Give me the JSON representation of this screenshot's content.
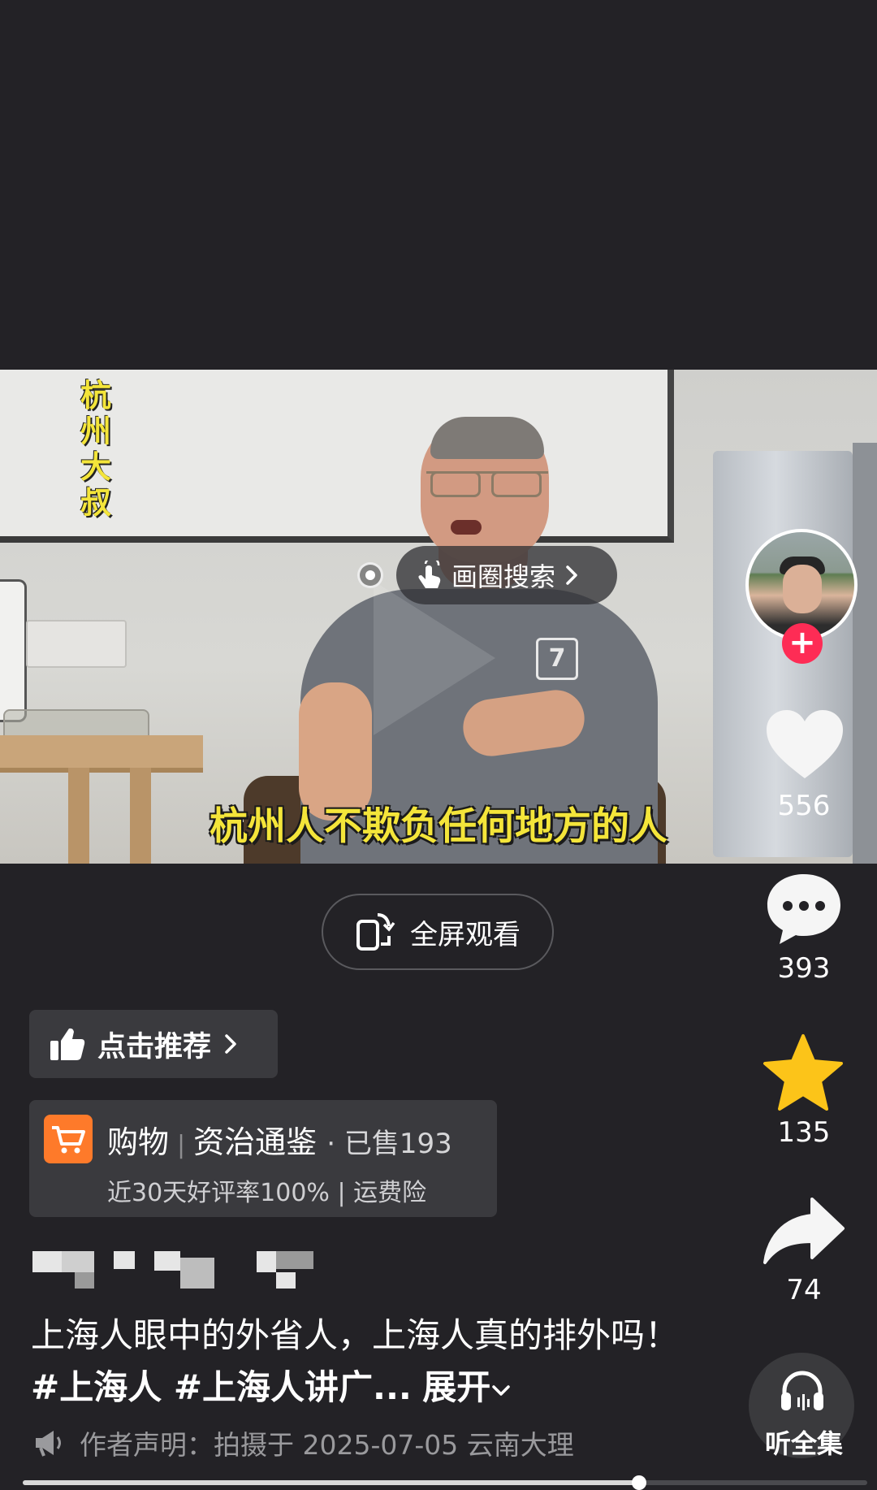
{
  "video": {
    "corner_caption": "杭州大叔",
    "subtitle": "杭州人不欺负任何地方的人",
    "circle_search_label": "画圈搜索",
    "shirt_logo": "7"
  },
  "rail": {
    "like_count": "556",
    "comment_count": "393",
    "favorite_count": "135",
    "share_count": "74",
    "listen_label": "听全集",
    "follow_plus": "+"
  },
  "fullscreen_label": "全屏观看",
  "recommend_label": "点击推荐",
  "shop": {
    "tag": "购物",
    "title": "资治通鉴",
    "sold": "· 已售193",
    "subline": "近30天好评率100% | 运费险"
  },
  "caption": {
    "text": "上海人眼中的外省人，上海人真的排外吗！",
    "tags": "#上海人 #上海人讲广...",
    "expand": "展开"
  },
  "declaration": "作者声明：拍摄于 2025-07-05 云南大理",
  "progress": 0.73,
  "colors": {
    "background": "#232226",
    "subtitle_yellow": "#f4e53a",
    "follow_red": "#fe2c55",
    "favorite_gold": "#fcc419",
    "shop_orange": "#fe7a2a"
  }
}
